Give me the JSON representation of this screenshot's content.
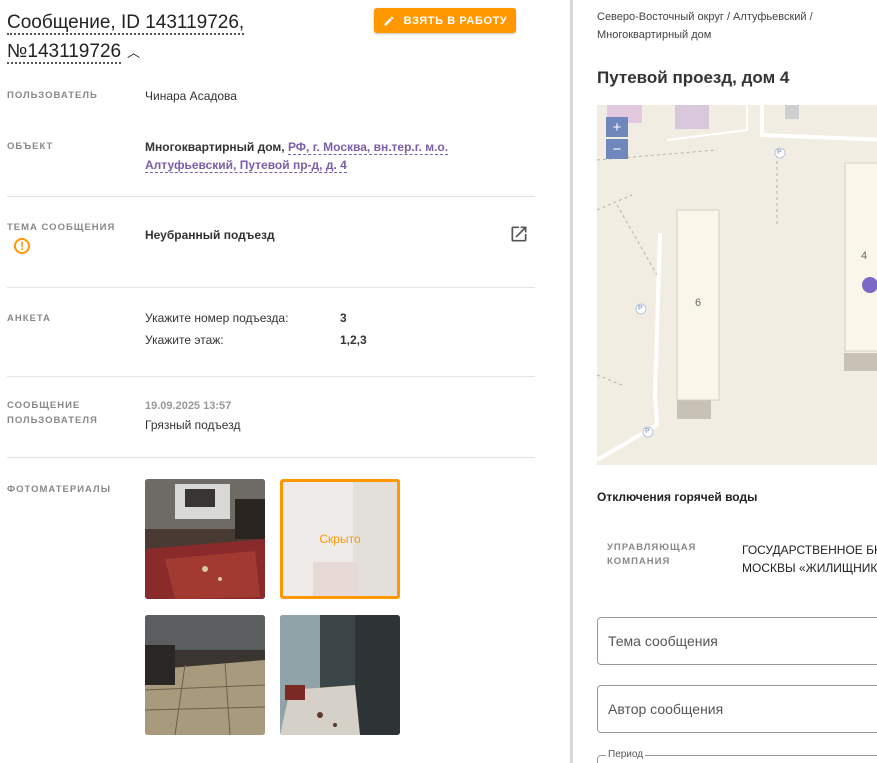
{
  "message": {
    "title_line1": "Сообщение, ID 143119726,",
    "title_line2": "№143119726",
    "take_button": "ВЗЯТЬ В РАБОТУ"
  },
  "fields": {
    "user_label": "ПОЛЬЗОВАТЕЛЬ",
    "user_value": "Чинара Асадова",
    "object_label": "ОБЪЕКТ",
    "object_type": "Многоквартирный дом,",
    "object_address": "РФ, г. Москва, вн.тер.г. м.о. Алтуфьевский, Путевой пр-д, д. 4",
    "topic_label": "ТЕМА СООБЩЕНИЯ",
    "topic_value": "Неубранный подъезд",
    "form_label": "АНКЕТА",
    "q1": "Укажите номер подъезда:",
    "a1": "3",
    "q2": "Укажите этаж:",
    "a2": "1,2,3",
    "msg_label_1": "СООБЩЕНИЕ",
    "msg_label_2": "ПОЛЬЗОВАТЕЛЯ",
    "msg_date": "19.09.2025 13:57",
    "msg_text": "Грязный подъезд",
    "photos_label": "ФОТОМАТЕРИАЛЫ",
    "hidden_text": "Скрыто"
  },
  "right": {
    "breadcrumb_1": "Северо-Восточный округ / Алтуфьевский /",
    "breadcrumb_2": "Многоквартирный дом",
    "address_title": "Путевой проезд, дом 4",
    "zoom_in": "+",
    "zoom_out": "−",
    "map_label_6": "6",
    "map_label_4": "4",
    "map_parking": "P",
    "section": "Отключения горячей воды",
    "mgmt_label_1": "УПРАВЛЯЮЩАЯ",
    "mgmt_label_2": "КОМПАНИЯ",
    "mgmt_value_1": "ГОСУДАРСТВЕННОЕ БК",
    "mgmt_value_2": "МОСКВЫ «ЖИЛИЩНИК",
    "topic_placeholder": "Тема сообщения",
    "author_placeholder": "Автор сообщения",
    "period_label": "Период"
  },
  "colors": {
    "accent": "#ff9800",
    "link": "#7b5ea7",
    "map_marker": "#7b68c8"
  }
}
